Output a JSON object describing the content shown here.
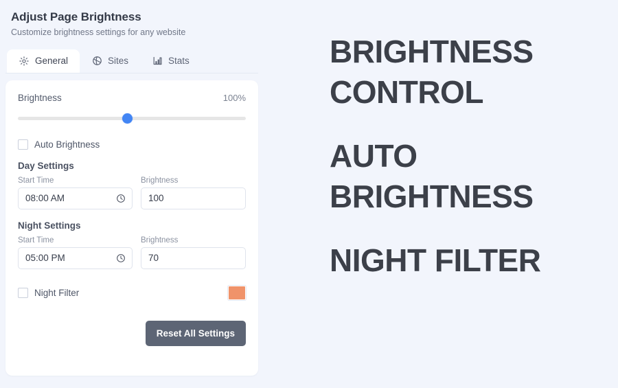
{
  "popup": {
    "title": "Adjust Page Brightness",
    "subtitle": "Customize brightness settings for any website",
    "tabs": [
      {
        "label": "General",
        "icon": "sun-icon",
        "active": true
      },
      {
        "label": "Sites",
        "icon": "globe-icon",
        "active": false
      },
      {
        "label": "Stats",
        "icon": "bar-chart-icon",
        "active": false
      }
    ],
    "brightness": {
      "label": "Brightness",
      "value_text": "100%",
      "slider_percent": 48,
      "accent_color": "#4285f4",
      "track_color": "#e6e6e6"
    },
    "auto_brightness": {
      "label": "Auto Brightness",
      "checked": false
    },
    "day_settings": {
      "heading": "Day Settings",
      "start_time_label": "Start Time",
      "start_time_value": "08:00 AM",
      "brightness_label": "Brightness",
      "brightness_value": "100"
    },
    "night_settings": {
      "heading": "Night Settings",
      "start_time_label": "Start Time",
      "start_time_value": "05:00 PM",
      "brightness_label": "Brightness",
      "brightness_value": "70"
    },
    "night_filter": {
      "label": "Night Filter",
      "checked": false,
      "swatch_color": "#f0936a"
    },
    "reset_button": {
      "label": "Reset All Settings",
      "background": "#5d6575"
    }
  },
  "right_panel": {
    "headings": [
      "BRIGHTNESS CONTROL",
      "AUTO BRIGHTNESS",
      "NIGHT FILTER"
    ],
    "text_color": "#3c4049",
    "background": "#f2f5fc"
  }
}
